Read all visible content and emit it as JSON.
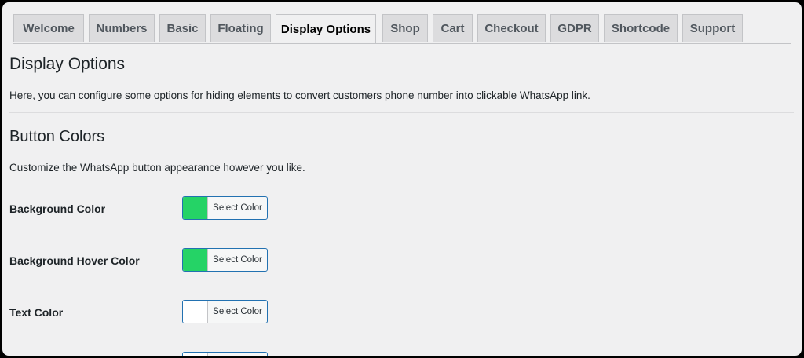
{
  "tabs": [
    {
      "label": "Welcome"
    },
    {
      "label": "Numbers"
    },
    {
      "label": "Basic"
    },
    {
      "label": "Floating"
    },
    {
      "label": "Display Options"
    },
    {
      "label": "Shop"
    },
    {
      "label": "Cart"
    },
    {
      "label": "Checkout"
    },
    {
      "label": "GDPR"
    },
    {
      "label": "Shortcode"
    },
    {
      "label": "Support"
    }
  ],
  "active_tab": "Display Options",
  "page": {
    "title": "Display Options",
    "intro": "Here, you can configure some options for hiding elements to convert customers phone number into clickable WhatsApp link."
  },
  "button_colors": {
    "heading": "Button Colors",
    "description": "Customize the WhatsApp button appearance however you like.",
    "fields": [
      {
        "label": "Background Color",
        "button": "Select Color",
        "color": "#25d366"
      },
      {
        "label": "Background Hover Color",
        "button": "Select Color",
        "color": "#25d366"
      },
      {
        "label": "Text Color",
        "button": "Select Color",
        "color": "#ffffff"
      },
      {
        "label": "",
        "button": "",
        "color": "#ffffff"
      }
    ]
  }
}
